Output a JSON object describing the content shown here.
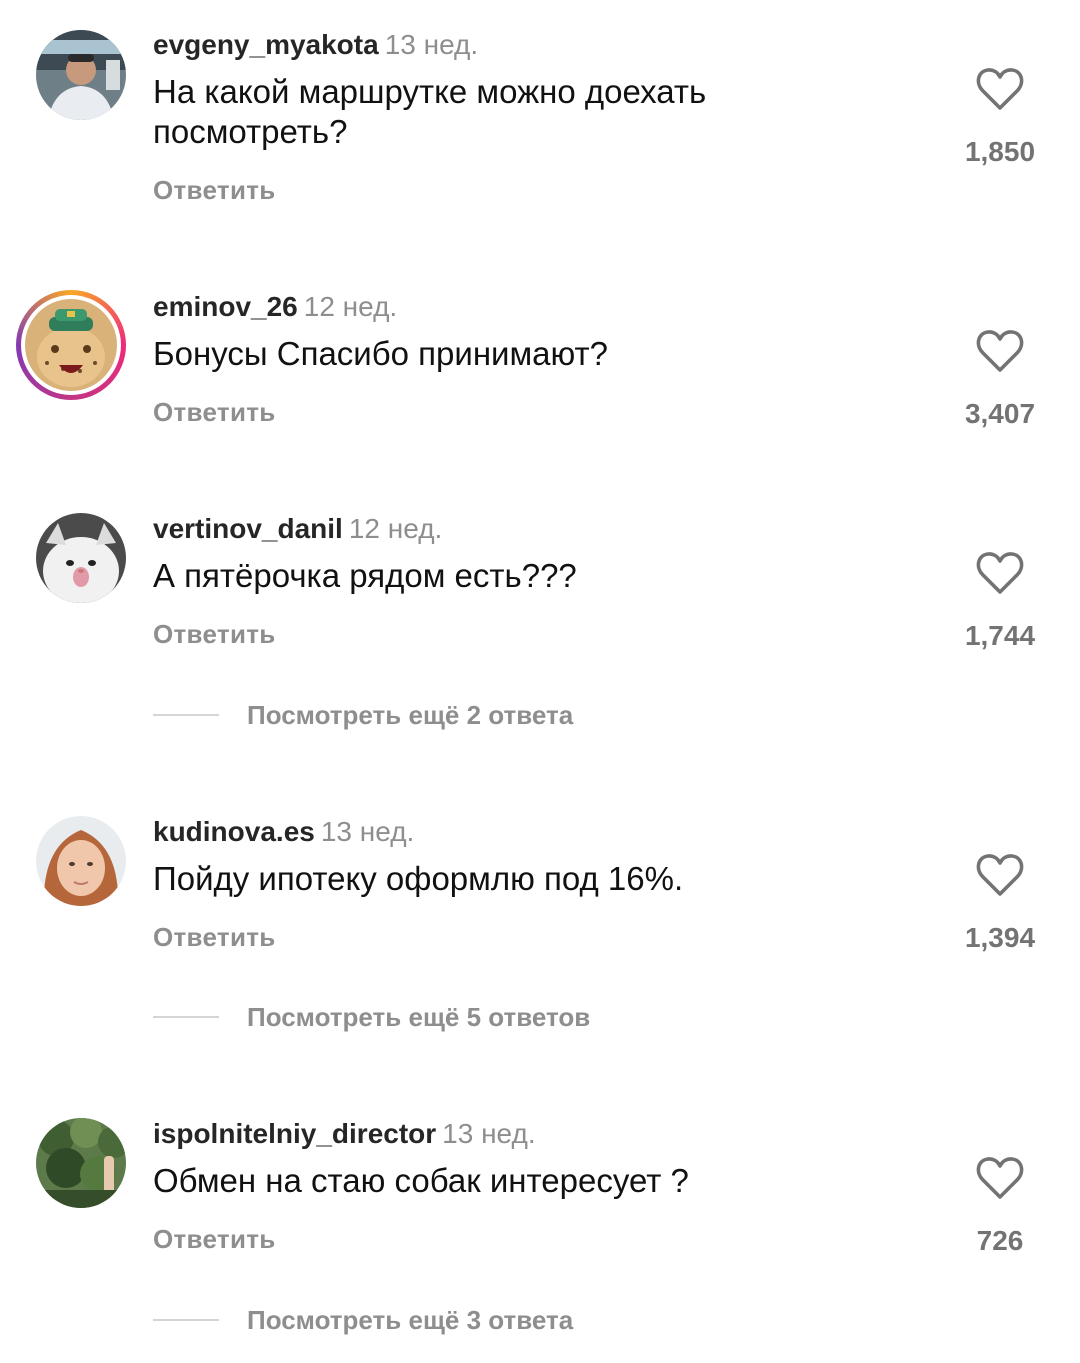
{
  "comments": [
    {
      "username": "evgeny_myakota",
      "time": "13 нед.",
      "text": "На какой маршрутке можно доехать посмотреть?",
      "reply_label": "Ответить",
      "likes": "1,850",
      "avatar_icon": "person-photo-avatar"
    },
    {
      "username": "eminov_26",
      "time": "12 нед.",
      "text": "Бонусы Спасибо принимают?",
      "reply_label": "Ответить",
      "likes": "3,407",
      "avatar_icon": "cheetah-avatar-with-story-ring"
    },
    {
      "username": "vertinov_danil",
      "time": "12 нед.",
      "text": "А пятёрочка рядом есть???",
      "reply_label": "Ответить",
      "likes": "1,744",
      "view_more": "Посмотреть ещё 2 ответа",
      "avatar_icon": "cat-avatar"
    },
    {
      "username": "kudinova.es",
      "time": "13 нед.",
      "text": "Пойду ипотеку оформлю под 16%.",
      "reply_label": "Ответить",
      "likes": "1,394",
      "view_more": "Посмотреть ещё 5 ответов",
      "avatar_icon": "woman-face-avatar"
    },
    {
      "username": "ispolnitelniy_director",
      "time": "13 нед.",
      "text": "Обмен на стаю собак интересует ?",
      "reply_label": "Ответить",
      "likes": "726",
      "view_more": "Посмотреть ещё 3 ответа",
      "avatar_icon": "forest-avatar"
    }
  ],
  "colors": {
    "username": "#262626",
    "secondary": "#8e8e8e",
    "like_count": "#737373",
    "divider": "#d5d5d5"
  }
}
